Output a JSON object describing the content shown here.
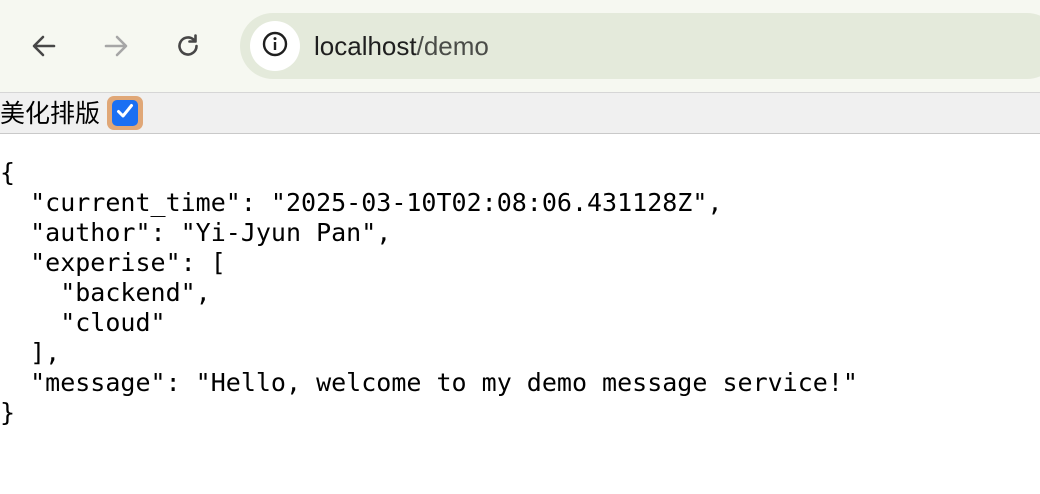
{
  "browser": {
    "url_host": "localhost",
    "url_path": "/demo",
    "icons": {
      "back": "arrow-left-icon",
      "forward": "arrow-right-icon",
      "reload": "reload-icon",
      "site_info": "info-icon"
    }
  },
  "options": {
    "prettify_label": "美化排版",
    "prettify_checked": true
  },
  "json_view": {
    "open_brace": "{",
    "current_time_line": "  \"current_time\": \"2025-03-10T02:08:06.431128Z\",",
    "author_line": "  \"author\": \"Yi-Jyun Pan\",",
    "experise_open_line": "  \"experise\": [",
    "experise_item_1": "    \"backend\",",
    "experise_item_2": "    \"cloud\"",
    "experise_close_line": "  ],",
    "message_line": "  \"message\": \"Hello, welcome to my demo message service!\"",
    "close_brace": "}"
  },
  "colors": {
    "toolbar_bg": "#f6f8f1",
    "omnibox_bg": "#e4eadb",
    "checkbox_accent": "#1a6ff3",
    "focus_ring": "#e0a777"
  }
}
